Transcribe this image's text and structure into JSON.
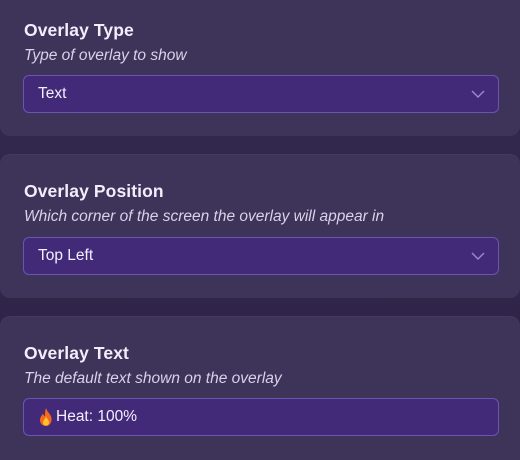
{
  "overlay_type": {
    "title": "Overlay Type",
    "description": "Type of overlay to show",
    "selected": "Text"
  },
  "overlay_position": {
    "title": "Overlay Position",
    "description": "Which corner of the screen the overlay will appear in",
    "selected": "Top Left"
  },
  "overlay_text": {
    "title": "Overlay Text",
    "description": "The default text shown on the overlay",
    "value": "Heat: 100%",
    "icon": "fire-icon"
  },
  "colors": {
    "card_bg": "#3e3359",
    "field_bg": "#432a79",
    "field_border": "#6a55b4"
  }
}
